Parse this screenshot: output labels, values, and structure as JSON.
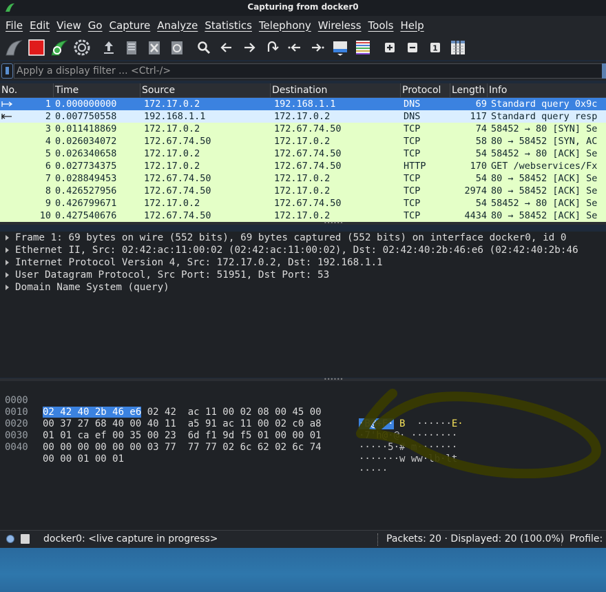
{
  "window": {
    "title": "Capturing from docker0"
  },
  "menu": [
    "File",
    "Edit",
    "View",
    "Go",
    "Capture",
    "Analyze",
    "Statistics",
    "Telephony",
    "Wireless",
    "Tools",
    "Help"
  ],
  "toolbar": {
    "icons": [
      "start-capture-icon",
      "stop-capture-icon",
      "restart-capture-icon",
      "capture-options-icon",
      "open-file-icon",
      "save-file-icon",
      "close-file-icon",
      "reload-file-icon",
      "find-packet-icon",
      "go-back-icon",
      "go-forward-icon",
      "go-to-packet-icon",
      "go-first-packet-icon",
      "go-last-packet-icon",
      "auto-scroll-icon",
      "colorize-icon",
      "zoom-in-icon",
      "zoom-out-icon",
      "normal-size-icon",
      "resize-columns-icon"
    ],
    "normal_size_label": "1"
  },
  "filter": {
    "placeholder": "Apply a display filter ... <Ctrl-/>"
  },
  "packet_list": {
    "columns": [
      "No.",
      "Time",
      "Source",
      "Destination",
      "Protocol",
      "Length",
      "Info"
    ],
    "rows": [
      {
        "no": "1",
        "time": "0.000000000",
        "src": "172.17.0.2",
        "dst": "192.168.1.1",
        "proto": "DNS",
        "len": "69",
        "info": "Standard query 0x9c",
        "kind": "sel"
      },
      {
        "no": "2",
        "time": "0.007750558",
        "src": "192.168.1.1",
        "dst": "172.17.0.2",
        "proto": "DNS",
        "len": "117",
        "info": "Standard query resp",
        "kind": "dns"
      },
      {
        "no": "3",
        "time": "0.011418869",
        "src": "172.17.0.2",
        "dst": "172.67.74.50",
        "proto": "TCP",
        "len": "74",
        "info": "58452 → 80 [SYN] Se",
        "kind": "tcp"
      },
      {
        "no": "4",
        "time": "0.026034072",
        "src": "172.67.74.50",
        "dst": "172.17.0.2",
        "proto": "TCP",
        "len": "58",
        "info": "80 → 58452 [SYN, AC",
        "kind": "tcp"
      },
      {
        "no": "5",
        "time": "0.026340658",
        "src": "172.17.0.2",
        "dst": "172.67.74.50",
        "proto": "TCP",
        "len": "54",
        "info": "58452 → 80 [ACK] Se",
        "kind": "tcp"
      },
      {
        "no": "6",
        "time": "0.027734375",
        "src": "172.17.0.2",
        "dst": "172.67.74.50",
        "proto": "HTTP",
        "len": "170",
        "info": "GET /webservices/Fx",
        "kind": "tcp"
      },
      {
        "no": "7",
        "time": "0.028849453",
        "src": "172.67.74.50",
        "dst": "172.17.0.2",
        "proto": "TCP",
        "len": "54",
        "info": "80 → 58452 [ACK] Se",
        "kind": "tcp"
      },
      {
        "no": "8",
        "time": "0.426527956",
        "src": "172.67.74.50",
        "dst": "172.17.0.2",
        "proto": "TCP",
        "len": "2974",
        "info": "80 → 58452 [ACK] Se",
        "kind": "tcp"
      },
      {
        "no": "9",
        "time": "0.426799671",
        "src": "172.17.0.2",
        "dst": "172.67.74.50",
        "proto": "TCP",
        "len": "54",
        "info": "58452 → 80 [ACK] Se",
        "kind": "tcp"
      },
      {
        "no": "10",
        "time": "0.427540676",
        "src": "172.67.74.50",
        "dst": "172.17.0.2",
        "proto": "TCP",
        "len": "4434",
        "info": "80 → 58452 [ACK] Se",
        "kind": "tcp"
      }
    ]
  },
  "details": [
    "Frame 1: 69 bytes on wire (552 bits), 69 bytes captured (552 bits) on interface docker0, id 0",
    "Ethernet II, Src: 02:42:ac:11:00:02 (02:42:ac:11:00:02), Dst: 02:42:40:2b:46:e6 (02:42:40:2b:46",
    "Internet Protocol Version 4, Src: 172.17.0.2, Dst: 192.168.1.1",
    "User Datagram Protocol, Src Port: 51951, Dst Port: 53",
    "Domain Name System (query)"
  ],
  "bytes": {
    "offsets": [
      "0000",
      "0010",
      "0020",
      "0030",
      "0040"
    ],
    "row0": {
      "hex_sel": "02 42 40 2b 46 e6",
      "hex_rest": " 02 42  ac 11 00 02 08 00 45 00",
      "asc_sel": "·B@+F·",
      "asc_rest_y": " B",
      "asc_rest": "  ······",
      "asc_end": "E·"
    },
    "row1": {
      "hex": "00 37 27 68 40 00 40 11  a5 91 ac 11 00 02 c0 a8",
      "asc_a": "·7'",
      "asc_b": "h@",
      "asc_c": "·@· ········"
    },
    "row2": {
      "hex": "01 01 ca ef 00 35 00 23  6d f1 9d f5 01 00 00 01",
      "asc": "·····5·# m·······"
    },
    "row3": {
      "hex": "00 00 00 00 00 00 03 77  77 77 02 6c 62 02 6c 74",
      "asc": "·······w ww·lb·lt"
    },
    "row4": {
      "hex": "00 00 01 00 01",
      "asc": "·····"
    }
  },
  "status": {
    "capture": "docker0: <live capture in progress>",
    "packets": "Packets: 20 · Displayed: 20 (100.0%)",
    "profile": "Profile:"
  },
  "colors": {
    "selected": "#3b82e0",
    "tcp_row": "#e4ffc7",
    "dns_row": "#daeeff",
    "stop_red": "#e01b1b",
    "scribble": "#3a3c00"
  }
}
